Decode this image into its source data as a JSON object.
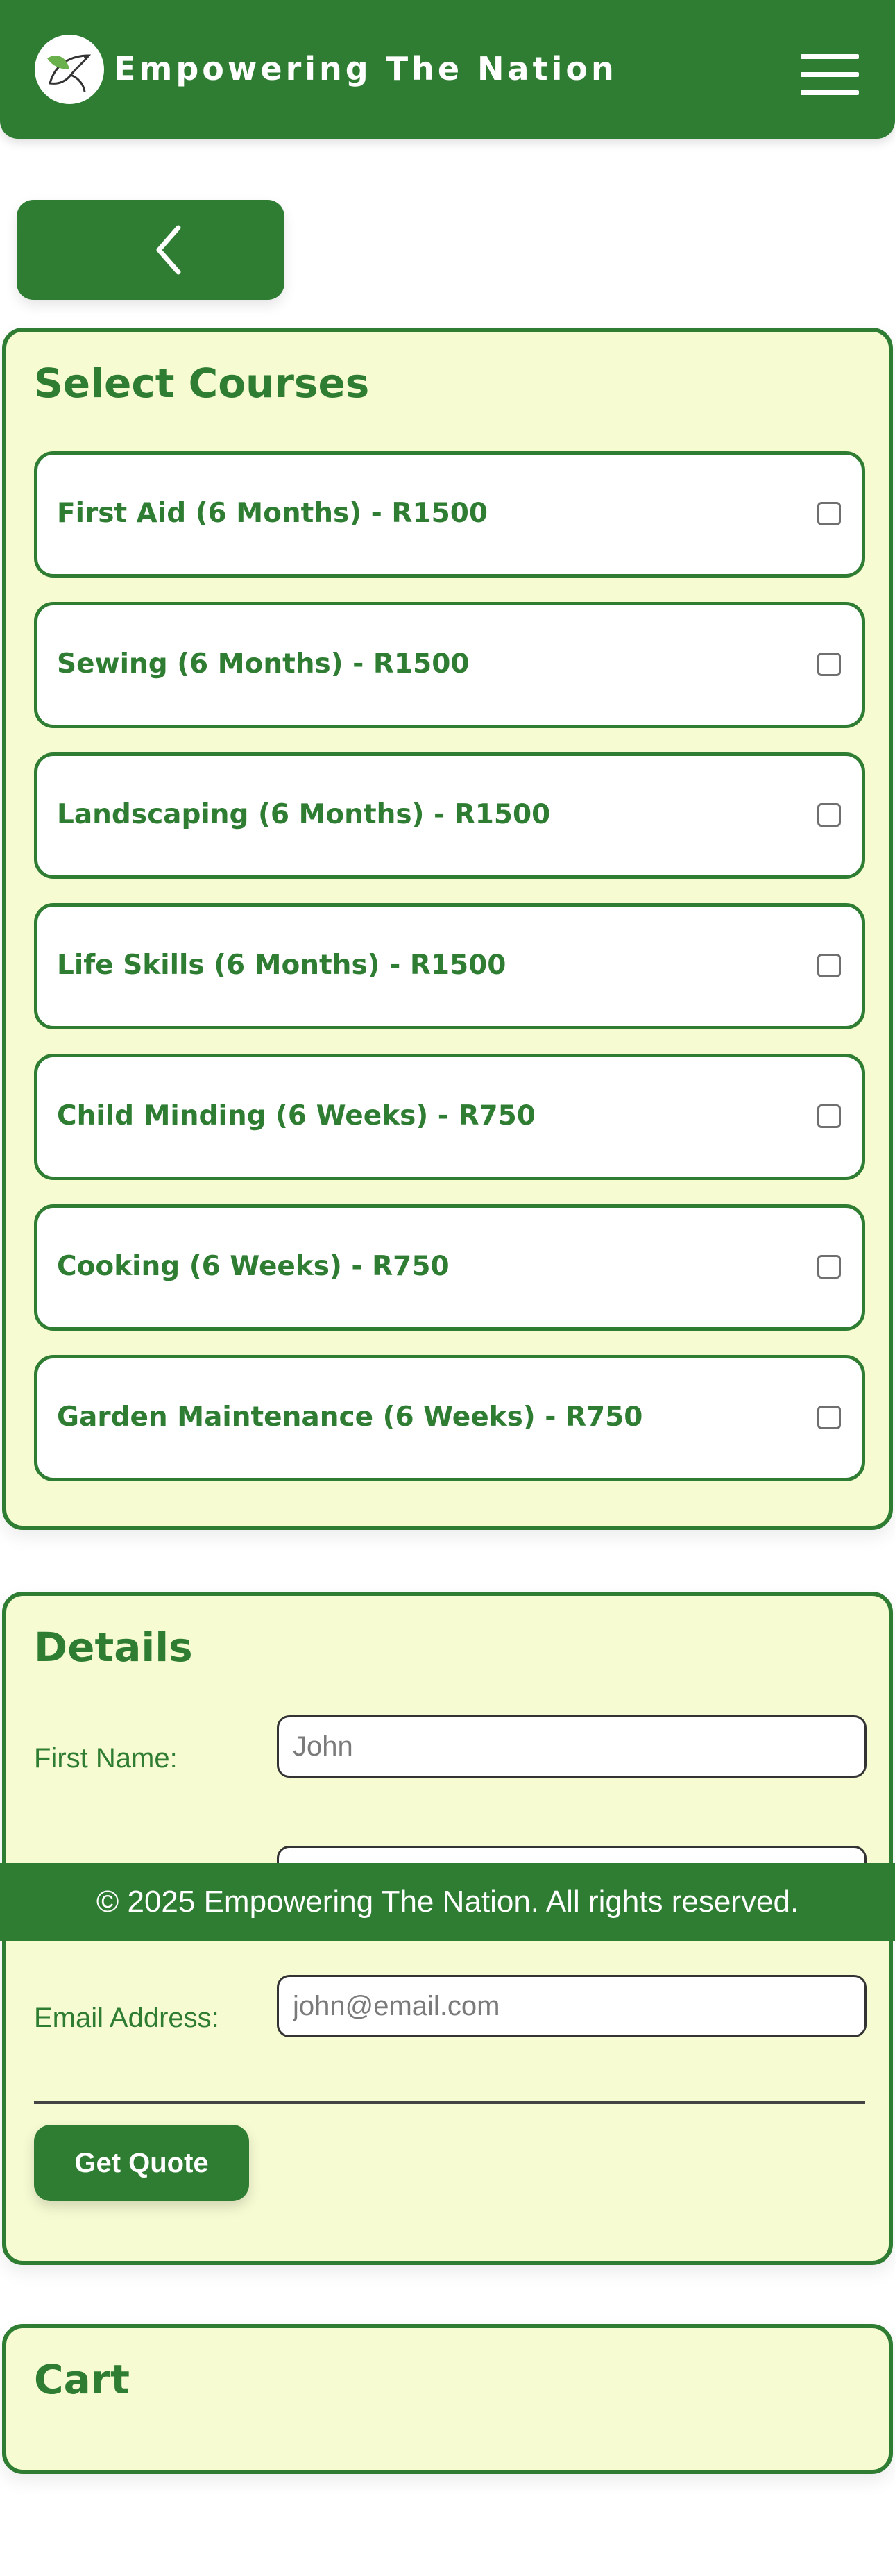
{
  "header": {
    "brand": "Empowering The Nation",
    "logo_icon": "dove-logo-icon",
    "menu_icon": "hamburger-menu-icon"
  },
  "nav": {
    "back_icon": "chevron-left-icon"
  },
  "select_courses": {
    "title": "Select Courses",
    "courses": [
      {
        "label": "First Aid (6 Months) - R1500",
        "checked": false
      },
      {
        "label": "Sewing (6 Months) - R1500",
        "checked": false
      },
      {
        "label": "Landscaping (6 Months) - R1500",
        "checked": false
      },
      {
        "label": "Life Skills (6 Months) - R1500",
        "checked": false
      },
      {
        "label": "Child Minding (6 Weeks) - R750",
        "checked": false
      },
      {
        "label": "Cooking (6 Weeks) - R750",
        "checked": false
      },
      {
        "label": "Garden Maintenance (6 Weeks) - R750",
        "checked": false
      }
    ]
  },
  "details": {
    "title": "Details",
    "first_name": {
      "label": "First Name:",
      "placeholder": "John"
    },
    "email": {
      "label": "Email Address:",
      "placeholder": "john@email.com"
    },
    "submit_label": "Get Quote"
  },
  "cart": {
    "title": "Cart"
  },
  "footer": {
    "copyright": "© 2025 Empowering The Nation. All rights reserved."
  },
  "colors": {
    "primary": "#2e7d32",
    "panel_bg": "#f6fbd2",
    "white": "#ffffff"
  }
}
